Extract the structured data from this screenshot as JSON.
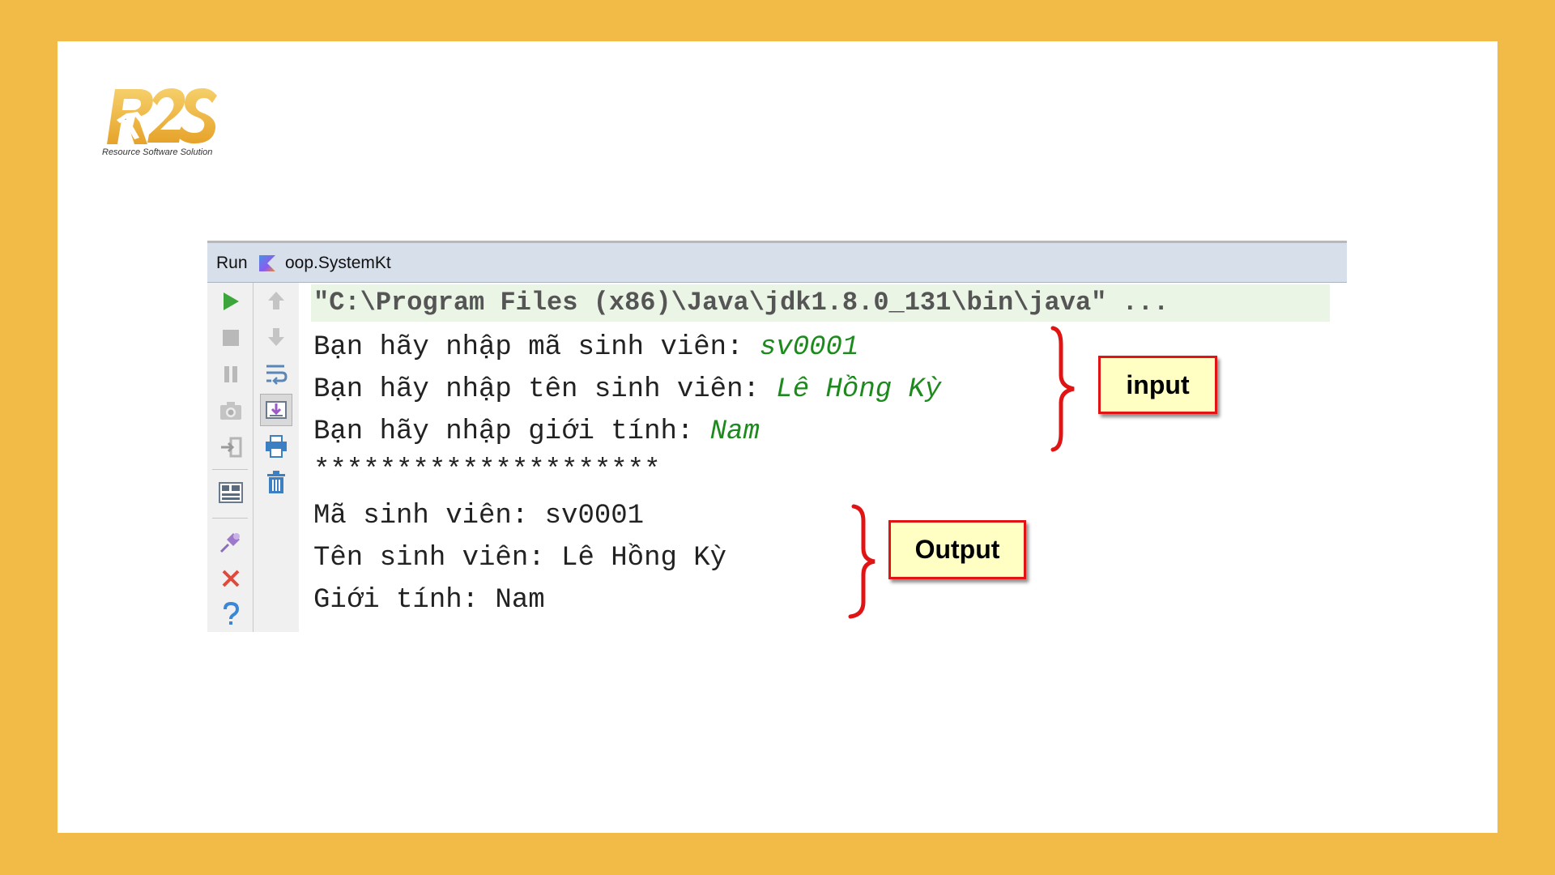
{
  "logo": {
    "mark": "R2S",
    "tagline": "Resource Software Solution"
  },
  "ide": {
    "run_label": "Run",
    "config_name": "oop.SystemKt",
    "left_toolbar": [
      "run-icon",
      "stop-icon",
      "pause-icon",
      "camera-icon",
      "login-icon",
      "layout-icon",
      "pin-icon",
      "close-icon",
      "help-icon"
    ],
    "right_toolbar": [
      "arrow-up-icon",
      "arrow-down-icon",
      "soft-wrap-icon",
      "scroll-to-end-icon",
      "print-icon",
      "trash-icon"
    ]
  },
  "console": {
    "command": "\"C:\\Program Files (x86)\\Java\\jdk1.8.0_131\\bin\\java\" ...",
    "prompts": [
      {
        "prompt": "Bạn hãy nhập mã sinh viên: ",
        "value": "sv0001"
      },
      {
        "prompt": "Bạn hãy nhập tên sinh viên: ",
        "value": "Lê Hồng Kỳ"
      },
      {
        "prompt": "Bạn hãy nhập giới tính: ",
        "value": "Nam"
      }
    ],
    "separator": "*********************",
    "outputs": [
      "Mã sinh viên: sv0001",
      "Tên sinh viên: Lê Hồng Kỳ",
      "Giới tính: Nam"
    ]
  },
  "annotations": {
    "input_label": "input",
    "output_label": "Output"
  },
  "colors": {
    "background": "#f2bb47",
    "input_text": "#1c8a1c",
    "callout_border": "#e01414",
    "callout_fill": "#ffffc4"
  }
}
